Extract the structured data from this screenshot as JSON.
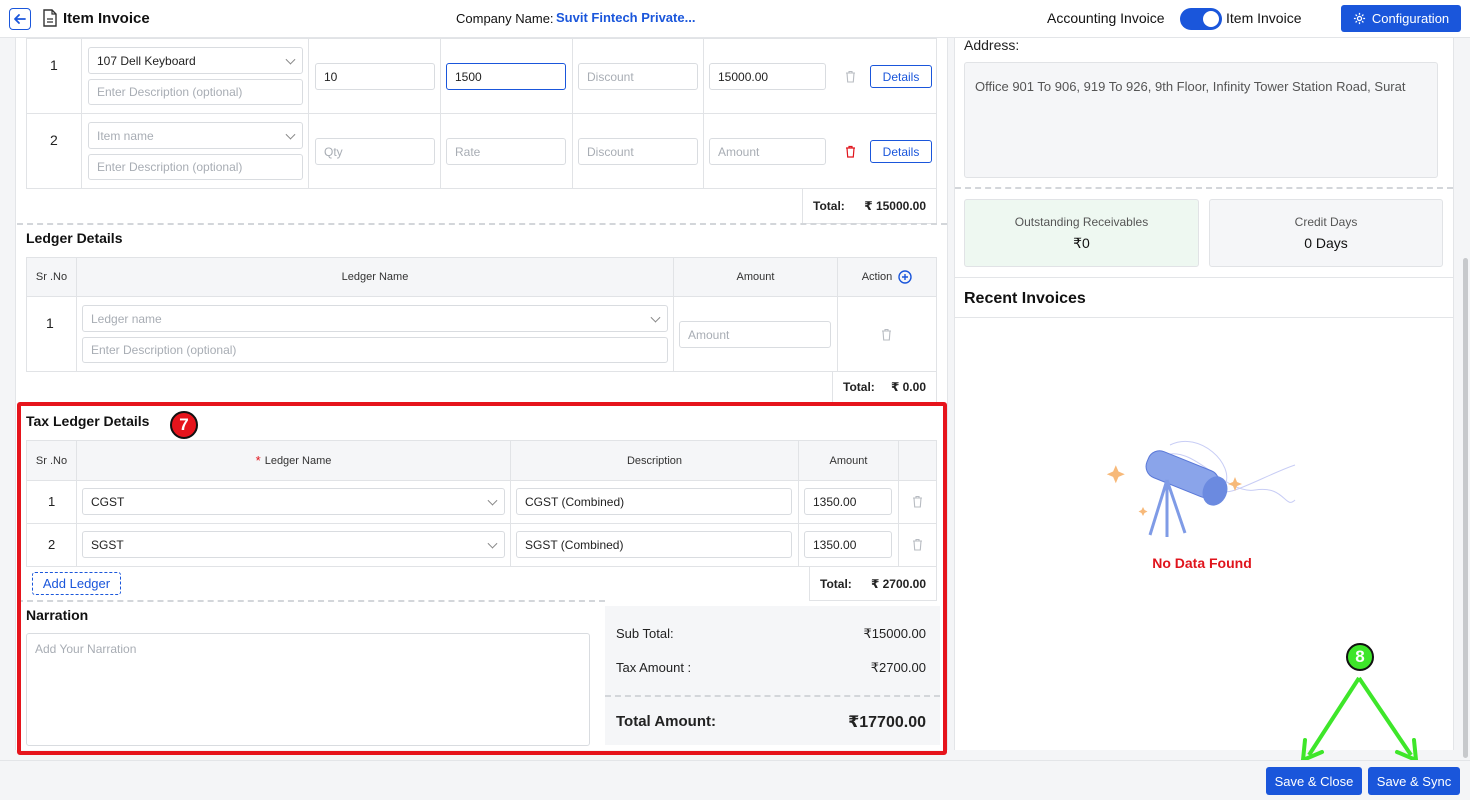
{
  "header": {
    "title": "Item Invoice",
    "company_label": "Company Name:",
    "company_name": "Suvit Fintech Private...",
    "mode_left": "Accounting Invoice",
    "mode_right": "Item Invoice",
    "config_label": "Configuration"
  },
  "items": {
    "rows": [
      {
        "sr": "1",
        "item": "107 Dell Keyboard",
        "description_ph": "Enter Description (optional)",
        "qty": "10",
        "rate": "1500",
        "discount_ph": "Discount",
        "amount": "15000.00",
        "details": "Details"
      },
      {
        "sr": "2",
        "item_ph": "Item name",
        "description_ph": "Enter Description (optional)",
        "qty_ph": "Qty",
        "rate_ph": "Rate",
        "discount_ph": "Discount",
        "amount_ph": "Amount",
        "details": "Details"
      }
    ],
    "total_label": "Total:",
    "total_value": "₹ 15000.00"
  },
  "ledger": {
    "title": "Ledger Details",
    "headers": {
      "sr": "Sr .No",
      "name": "Ledger Name",
      "amount": "Amount",
      "action": "Action"
    },
    "row": {
      "sr": "1",
      "name_ph": "Ledger name",
      "description_ph": "Enter Description (optional)",
      "amount_ph": "Amount"
    },
    "total_label": "Total:",
    "total_value": "₹ 0.00"
  },
  "tax": {
    "title": "Tax Ledger Details",
    "badge": "7",
    "headers": {
      "sr": "Sr .No",
      "required": "*",
      "name": "Ledger Name",
      "description": "Description",
      "amount": "Amount"
    },
    "rows": [
      {
        "sr": "1",
        "name": "CGST",
        "description": "CGST (Combined)",
        "amount": "1350.00"
      },
      {
        "sr": "2",
        "name": "SGST",
        "description": "SGST (Combined)",
        "amount": "1350.00"
      }
    ],
    "add_label": "Add Ledger",
    "total_label": "Total:",
    "total_value": "₹ 2700.00"
  },
  "narration": {
    "title": "Narration",
    "placeholder": "Add Your Narration"
  },
  "summary": {
    "sub_total_label": "Sub Total:",
    "sub_total": "₹15000.00",
    "tax_label": "Tax Amount :",
    "tax": "₹2700.00",
    "total_label": "Total Amount:",
    "total": "₹17700.00"
  },
  "customer": {
    "address_label": "Address:",
    "address": "Office 901 To 906, 919 To 926, 9th Floor, Infinity Tower Station Road, Surat",
    "outstanding_label": "Outstanding Receivables",
    "outstanding": "₹0",
    "credit_label": "Credit Days",
    "credit": "0 Days",
    "recent_title": "Recent Invoices",
    "no_data": "No Data Found"
  },
  "footer": {
    "save_close": "Save & Close",
    "save_sync": "Save & Sync",
    "badge": "8"
  },
  "colors": {
    "primary": "#1a56db",
    "highlight_red": "#e6141c",
    "highlight_green": "#3ee62a"
  }
}
